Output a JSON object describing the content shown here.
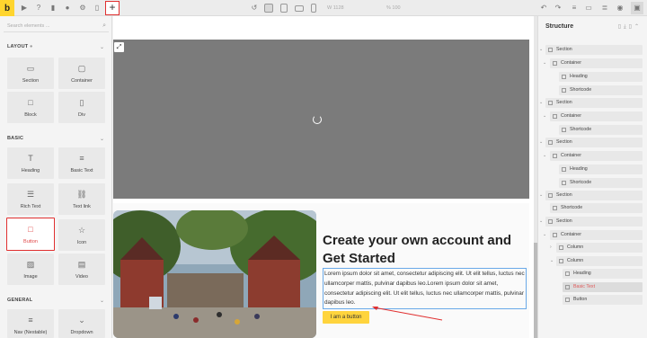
{
  "topbar": {
    "logo": "b",
    "width_value": "1128",
    "height_value": "",
    "zoom_value": "100",
    "width_prefix": "W",
    "zoom_prefix": "%",
    "plus": "+"
  },
  "left_panel": {
    "search_placeholder": "Search elements ...",
    "layout_heading": "LAYOUT",
    "basic_heading": "BASIC",
    "general_heading": "GENERAL",
    "layout_tiles": [
      "Section",
      "Container",
      "Block",
      "Div"
    ],
    "basic_tiles": [
      "Heading",
      "Basic Text",
      "Rich Text",
      "Text link",
      "Button",
      "Icon",
      "Image",
      "Video"
    ],
    "general_tiles": [
      "Nav (Nestable)",
      "Dropdown"
    ]
  },
  "canvas": {
    "heading": "Create your own account and Get Started",
    "paragraph": "Lorem ipsum dolor sit amet, consectetur adipiscing elit. Ut elit tellus, luctus nec ullamcorper mattis, pulvinar dapibus leo.Lorem ipsum dolor sit amet, consectetur adipiscing elit. Ut elit tellus, luctus nec ullamcorper mattis, pulvinar dapibus leo.",
    "button": "I am a button"
  },
  "structure": {
    "title": "Structure",
    "nodes": [
      {
        "label": "Section"
      },
      {
        "label": "Container"
      },
      {
        "label": "Heading"
      },
      {
        "label": "Shortcode"
      },
      {
        "label": "Section"
      },
      {
        "label": "Container"
      },
      {
        "label": "Shortcode"
      },
      {
        "label": "Section"
      },
      {
        "label": "Container"
      },
      {
        "label": "Heading"
      },
      {
        "label": "Shortcode"
      },
      {
        "label": "Section"
      },
      {
        "label": "Shortcode"
      },
      {
        "label": "Section"
      },
      {
        "label": "Container"
      },
      {
        "label": "Column"
      },
      {
        "label": "Column"
      },
      {
        "label": "Heading"
      },
      {
        "label": "Basic Text"
      },
      {
        "label": "Button"
      }
    ]
  },
  "colors": {
    "brand_yellow": "#ffd52e",
    "highlight_red": "#e03030",
    "button_yellow": "#ffd43d"
  }
}
